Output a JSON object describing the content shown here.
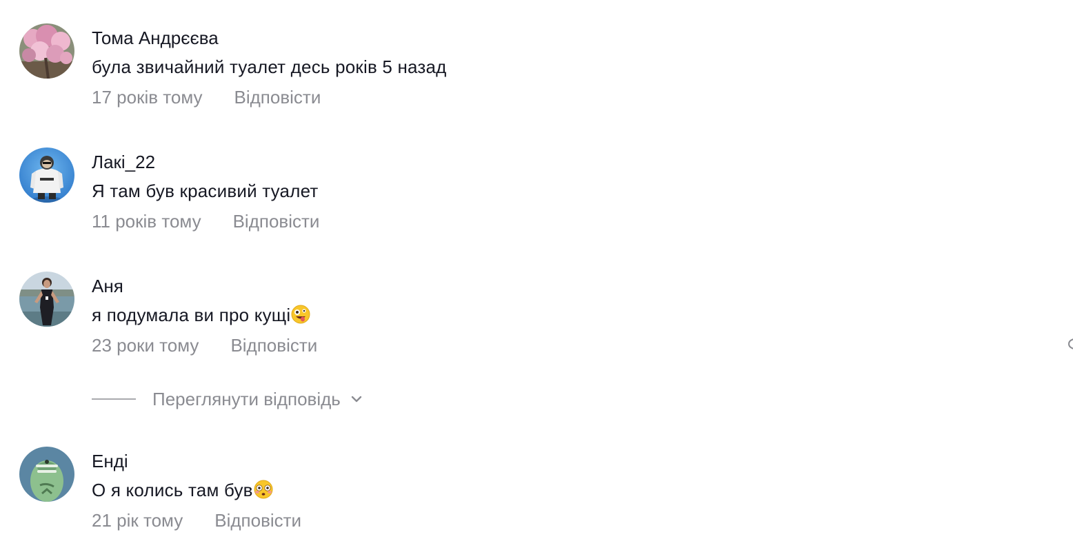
{
  "reply_label": "Відповісти",
  "comments": [
    {
      "author": "Тома Андрєєва",
      "text": "була звичайний туалет десь років 5 назад",
      "time": "17 років тому",
      "avatar_icon": "pink-blossom-avatar"
    },
    {
      "author": "Лакі_22",
      "text": "Я там був красивий туалет",
      "time": "11 років тому",
      "avatar_icon": "hoodie-person-avatar"
    },
    {
      "author": "Аня",
      "text": "я подумала ви про кущі",
      "emoji": "zany-face-emoji",
      "time": "23 роки тому",
      "avatar_icon": "woman-by-water-avatar"
    },
    {
      "author": "Енді",
      "text": "О я колись там був",
      "emoji": "flushed-face-emoji",
      "time": "21 рік тому",
      "avatar_icon": "green-cartoon-avatar"
    }
  ],
  "view_replies": {
    "label": "Переглянути відповідь",
    "icon": "chevron-down-icon"
  },
  "colors": {
    "primary_text": "#161823",
    "secondary_text": "#8a8b91",
    "background": "#ffffff"
  }
}
